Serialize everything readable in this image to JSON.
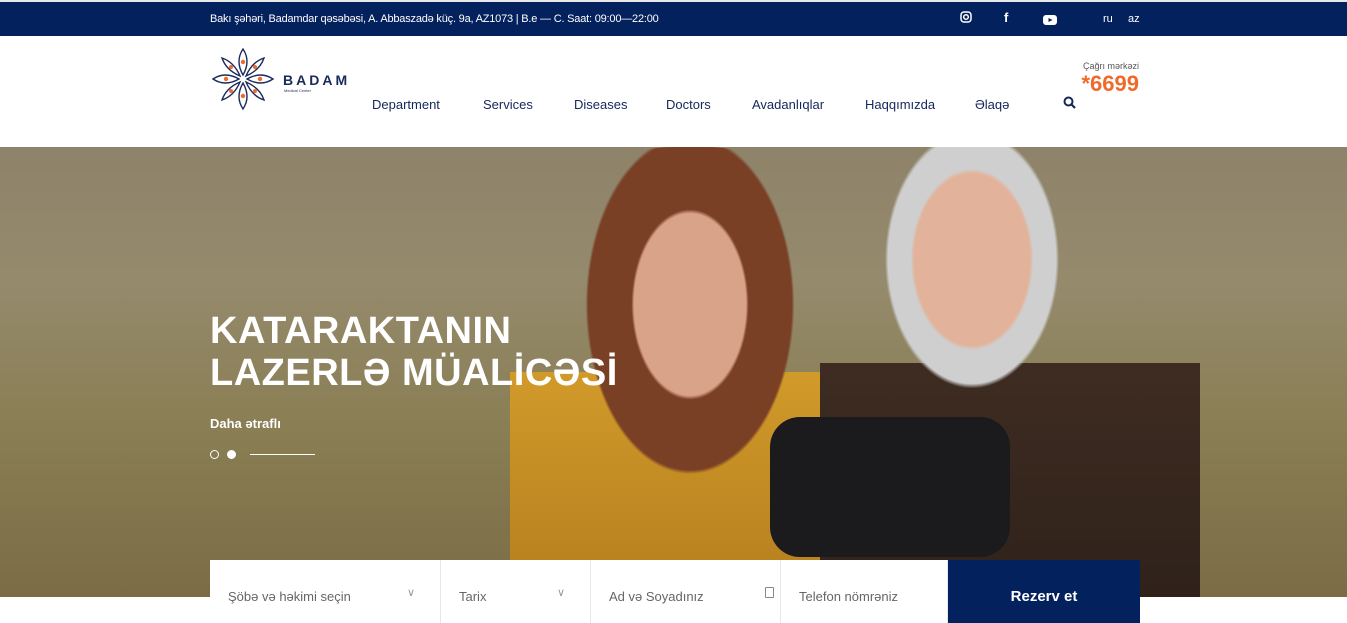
{
  "topbar": {
    "address": "Bakı şəhəri, Badamdar qəsəbəsi, A. Abbaszadə küç. 9a, AZ1073 | B.e — C. Saat: 09:00—22:00",
    "social": [
      "instagram-icon",
      "facebook-icon",
      "youtube-icon"
    ],
    "languages": [
      "ru",
      "az"
    ]
  },
  "header": {
    "brand": "BADAM",
    "brand_sub": "Medical Center",
    "nav": [
      "Department",
      "Services",
      "Diseases",
      "Doctors",
      "Avadanlıqlar",
      "Haqqımızda",
      "Əlaqə"
    ],
    "call_label": "Çağrı mərkəzi",
    "call_number": "*6699"
  },
  "hero": {
    "title_line1": "KATARAKTANIN",
    "title_line2": "LAZERLƏ MÜALİCƏSİ",
    "more": "Daha ətraflı",
    "active_slide": 2,
    "slides": 2
  },
  "form": {
    "department_placeholder": "Şöbə və həkimi seçin",
    "date_placeholder": "Tarix",
    "name_placeholder": "Ad və Soyadınız",
    "phone_placeholder": "Telefon nömrəniz",
    "submit": "Rezerv et"
  },
  "colors": {
    "navy": "#03215c",
    "accent": "#ef6a2a"
  }
}
